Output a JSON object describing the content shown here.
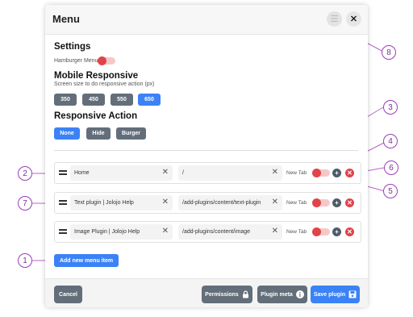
{
  "header": {
    "title": "Menu"
  },
  "settings": {
    "title": "Settings",
    "hamburger_label": "Hamburger Menu",
    "mobile_title": "Mobile Responsive",
    "mobile_hint": "Screen size to do responsive action (px)",
    "sizes": [
      "350",
      "450",
      "550",
      "650"
    ],
    "selected_size": "650",
    "action_title": "Responsive Action",
    "actions": [
      "None",
      "Hide",
      "Burger"
    ],
    "selected_action": "None"
  },
  "items": [
    {
      "title": "Home",
      "url": "/",
      "newtab_label": "New Tab"
    },
    {
      "title": "Text plugin | Jolojo Help",
      "url": "/add-plugins/content/text-plugin",
      "newtab_label": "New Tab"
    },
    {
      "title": "Image Plugin | Jolojo Help",
      "url": "/add-plugins/content/image",
      "newtab_label": "New Tab"
    }
  ],
  "add_item_label": "Add new menu item",
  "footer": {
    "cancel": "Cancel",
    "permissions": "Permissions",
    "plugin_meta": "Plugin meta",
    "save": "Save plugin"
  },
  "callouts": [
    "1",
    "2",
    "3",
    "4",
    "5",
    "6",
    "7",
    "8"
  ],
  "colors": {
    "accent": "#3b82f6",
    "danger": "#e0434a",
    "callout": "#9b3fb6",
    "button_gray": "#636e7a"
  }
}
